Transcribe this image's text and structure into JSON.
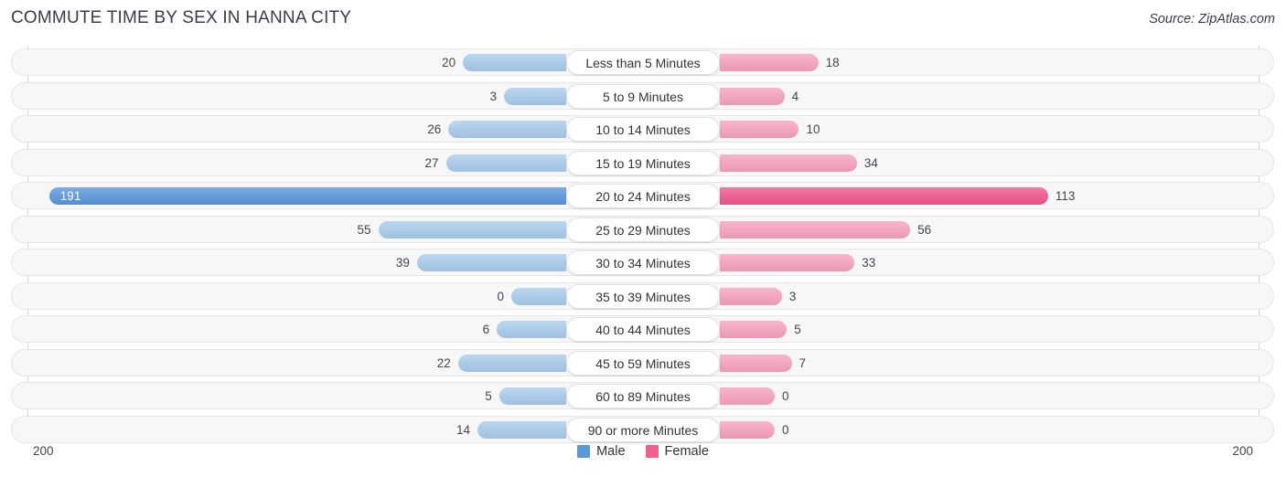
{
  "header": {
    "title": "COMMUTE TIME BY SEX IN HANNA CITY",
    "source": "Source: ZipAtlas.com"
  },
  "legend": {
    "male_label": "Male",
    "female_label": "Female",
    "male_color": "#5b9bd5",
    "female_color": "#ef5f92"
  },
  "axis": {
    "left_max": "200",
    "right_max": "200"
  },
  "colors": {
    "male_normal": "#a8cbec",
    "male_highlight": "#5795dc",
    "female_normal": "#f7a0bd",
    "female_highlight": "#f0548b",
    "track_bg": "#f7f7f7",
    "track_border": "#e6e6e6"
  },
  "chart_data": {
    "type": "bar",
    "orientation": "horizontal",
    "style": "diverging-bidirectional",
    "title": "COMMUTE TIME BY SEX IN HANNA CITY",
    "xlabel": "",
    "ylabel": "",
    "axis_max": 200,
    "grid": false,
    "legend_position": "bottom-center",
    "categories": [
      "Less than 5 Minutes",
      "5 to 9 Minutes",
      "10 to 14 Minutes",
      "15 to 19 Minutes",
      "20 to 24 Minutes",
      "25 to 29 Minutes",
      "30 to 34 Minutes",
      "35 to 39 Minutes",
      "40 to 44 Minutes",
      "45 to 59 Minutes",
      "60 to 89 Minutes",
      "90 or more Minutes"
    ],
    "series": [
      {
        "name": "Male",
        "values": [
          20,
          3,
          26,
          27,
          191,
          55,
          39,
          0,
          6,
          22,
          5,
          14
        ]
      },
      {
        "name": "Female",
        "values": [
          18,
          4,
          10,
          34,
          113,
          56,
          33,
          3,
          5,
          7,
          0,
          0
        ]
      }
    ],
    "highlighted_category": "20 to 24 Minutes"
  },
  "rows": [
    {
      "label": "Less than 5 Minutes",
      "male": 20,
      "male_text": "20",
      "female": 18,
      "female_text": "18",
      "highlight": false
    },
    {
      "label": "5 to 9 Minutes",
      "male": 3,
      "male_text": "3",
      "female": 4,
      "female_text": "4",
      "highlight": false
    },
    {
      "label": "10 to 14 Minutes",
      "male": 26,
      "male_text": "26",
      "female": 10,
      "female_text": "10",
      "highlight": false
    },
    {
      "label": "15 to 19 Minutes",
      "male": 27,
      "male_text": "27",
      "female": 34,
      "female_text": "34",
      "highlight": false
    },
    {
      "label": "20 to 24 Minutes",
      "male": 191,
      "male_text": "191",
      "female": 113,
      "female_text": "113",
      "highlight": true
    },
    {
      "label": "25 to 29 Minutes",
      "male": 55,
      "male_text": "55",
      "female": 56,
      "female_text": "56",
      "highlight": false
    },
    {
      "label": "30 to 34 Minutes",
      "male": 39,
      "male_text": "39",
      "female": 33,
      "female_text": "33",
      "highlight": false
    },
    {
      "label": "35 to 39 Minutes",
      "male": 0,
      "male_text": "0",
      "female": 3,
      "female_text": "3",
      "highlight": false
    },
    {
      "label": "40 to 44 Minutes",
      "male": 6,
      "male_text": "6",
      "female": 5,
      "female_text": "5",
      "highlight": false
    },
    {
      "label": "45 to 59 Minutes",
      "male": 22,
      "male_text": "22",
      "female": 7,
      "female_text": "7",
      "highlight": false
    },
    {
      "label": "60 to 89 Minutes",
      "male": 5,
      "male_text": "5",
      "female": 0,
      "female_text": "0",
      "highlight": false
    },
    {
      "label": "90 or more Minutes",
      "male": 14,
      "male_text": "14",
      "female": 0,
      "female_text": "0",
      "highlight": false
    }
  ]
}
